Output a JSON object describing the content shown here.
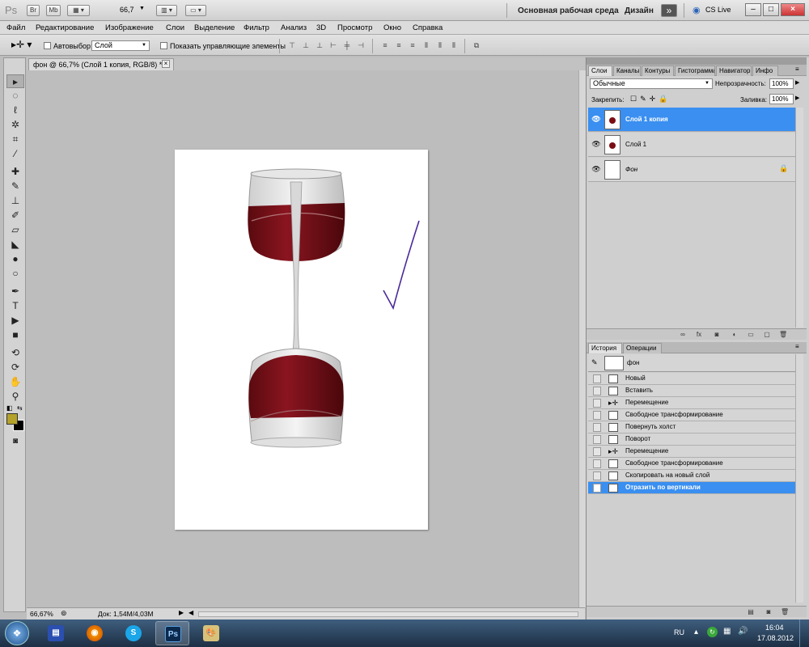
{
  "appbar": {
    "logo": "Ps",
    "btn_br": "Br",
    "btn_mb": "Mb",
    "zoom": "66,7",
    "workspace": "Основная рабочая среда",
    "design": "Дизайн",
    "more": "»",
    "cslive": "CS Live",
    "min": "–",
    "max": "□",
    "close": "×"
  },
  "menu": [
    "Файл",
    "Редактирование",
    "Изображение",
    "Слои",
    "Выделение",
    "Фильтр",
    "Анализ",
    "3D",
    "Просмотр",
    "Окно",
    "Справка"
  ],
  "options": {
    "autoselect_label": "Автовыбор:",
    "autoselect_value": "Слой",
    "show_controls_label": "Показать управляющие элементы"
  },
  "document": {
    "tab_title": "фон @ 66,7% (Слой 1 копия, RGB/8) *",
    "close": "×",
    "zoom": "66,67%",
    "doc_info": "Док: 1,54M/4,03M"
  },
  "layers_panel": {
    "tabs": [
      "Слои",
      "Каналы",
      "Контуры",
      "Гистограмма",
      "Навигатор",
      "Инфо"
    ],
    "blend_mode": "Обычные",
    "opacity_label": "Непрозрачность:",
    "opacity": "100%",
    "lock_label": "Закрепить:",
    "fill_label": "Заливка:",
    "fill": "100%",
    "layers": [
      {
        "name": "Слой 1 копия",
        "selected": true
      },
      {
        "name": "Слой 1",
        "selected": false
      },
      {
        "name": "Фон",
        "selected": false
      }
    ]
  },
  "history_panel": {
    "tabs": [
      "История",
      "Операции"
    ],
    "snapshot": "фон",
    "items": [
      "Новый",
      "Вставить",
      "Перемещение",
      "Свободное трансформирование",
      "Повернуть холст",
      "Поворот",
      "Перемещение",
      "Свободное трансформирование",
      "Скопировать на новый слой",
      "Отразить по вертикали"
    ]
  },
  "taskbar": {
    "lang": "RU",
    "time": "16:04",
    "date": "17.08.2012",
    "ps": "Ps"
  },
  "colors": {
    "selection": "#3a8ff0",
    "foreground": "#b4a22a",
    "background": "#000000",
    "wine": "#7a0d14"
  }
}
